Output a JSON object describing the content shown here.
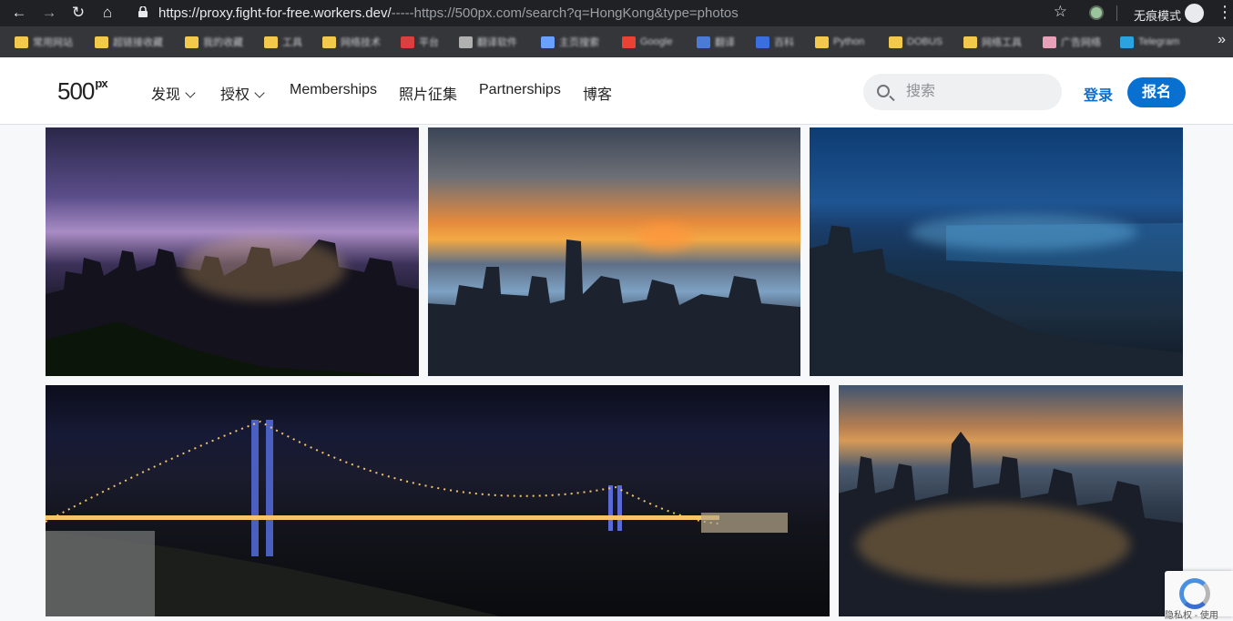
{
  "browser": {
    "url_host": "https://proxy.fight-for-free.workers.dev/",
    "url_rest": "-----https://500px.com/search?q=HongKong&type=photos",
    "incognito_label": "无痕模式",
    "bookmarks": [
      {
        "label": "常用网站",
        "color": "#f2c94c"
      },
      {
        "label": "超链接收藏",
        "color": "#f2c94c"
      },
      {
        "label": "我的收藏",
        "color": "#f2c94c"
      },
      {
        "label": "工具",
        "color": "#f2c94c"
      },
      {
        "label": "网络技术",
        "color": "#f2c94c"
      },
      {
        "label": "平台",
        "color": "#d94040"
      },
      {
        "label": "翻译软件",
        "color": "#b0b0b0"
      },
      {
        "label": "主页搜索",
        "color": "#6aa0ff"
      },
      {
        "label": "Google",
        "color": "#ea4335"
      },
      {
        "label": "翻译",
        "color": "#4a7bd6"
      },
      {
        "label": "百科",
        "color": "#3b6fe0"
      },
      {
        "label": "Python",
        "color": "#f2c94c"
      },
      {
        "label": "DOBUS",
        "color": "#f2c94c"
      },
      {
        "label": "网络工具",
        "color": "#f2c94c"
      },
      {
        "label": "广告网络",
        "color": "#e8a0b8"
      },
      {
        "label": "Telegram",
        "color": "#2aa3df"
      }
    ]
  },
  "site": {
    "logo": "500",
    "logo_sup": "px",
    "nav": [
      {
        "label": "发现",
        "dropdown": true
      },
      {
        "label": "授权",
        "dropdown": true
      },
      {
        "label": "Memberships",
        "dropdown": false
      },
      {
        "label": "照片征集",
        "dropdown": false
      },
      {
        "label": "Partnerships",
        "dropdown": false
      },
      {
        "label": "博客",
        "dropdown": false
      }
    ],
    "search_placeholder": "搜索",
    "login_label": "登录",
    "signup_label": "报名",
    "accent_color": "#0870d1"
  },
  "photos": [
    {
      "subject": "Hong Kong skyline at dusk, purple sky"
    },
    {
      "subject": "Victoria Harbour sunset from the Peak"
    },
    {
      "subject": "Victoria Harbour blue hour aerial"
    },
    {
      "subject": "Tsing Ma Bridge at night"
    },
    {
      "subject": "Hong Kong Island city lights at sunset"
    }
  ],
  "recaptcha_text": "隐私权 - 使用"
}
